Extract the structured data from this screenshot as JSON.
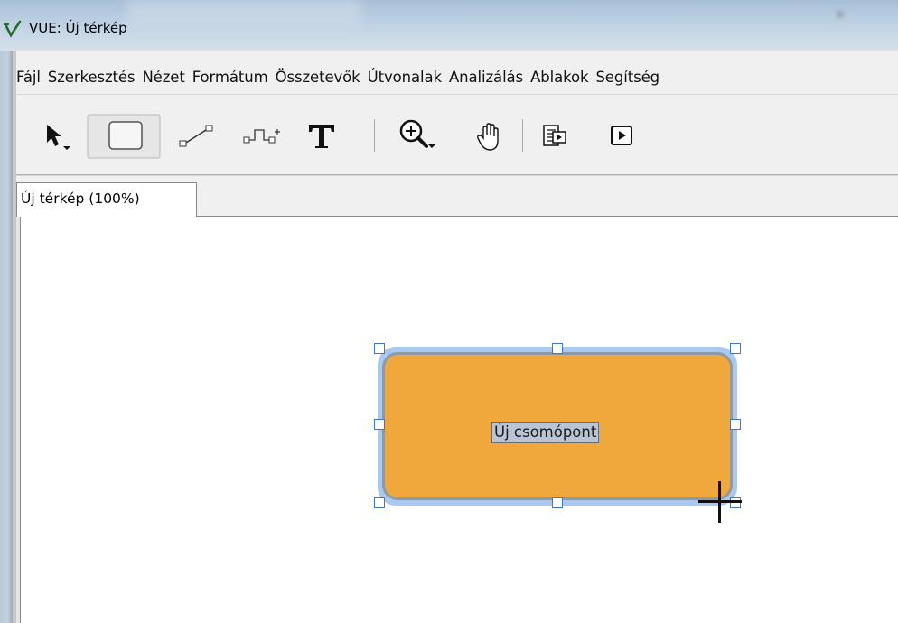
{
  "window": {
    "title": "VUE: Új térkép",
    "icon": "vue-logo-icon"
  },
  "menu": {
    "items": [
      "Fájl",
      "Szerkesztés",
      "Nézet",
      "Formátum",
      "Összetevők",
      "Útvonalak",
      "Analizálás",
      "Ablakok",
      "Segítség"
    ]
  },
  "toolbar": {
    "tools": [
      "selection-arrow-icon",
      "rectangle-node-icon",
      "link-tool-icon",
      "curve-link-icon",
      "text-tool-icon",
      "zoom-icon",
      "pan-hand-icon",
      "slide-viewer-icon",
      "presentation-play-icon"
    ]
  },
  "tabs": [
    {
      "label": "Új térkép (100%)"
    }
  ],
  "node": {
    "label": "Új csomópont",
    "fill_color": "#f0a73b",
    "selection_color": "#a9c9ee"
  }
}
